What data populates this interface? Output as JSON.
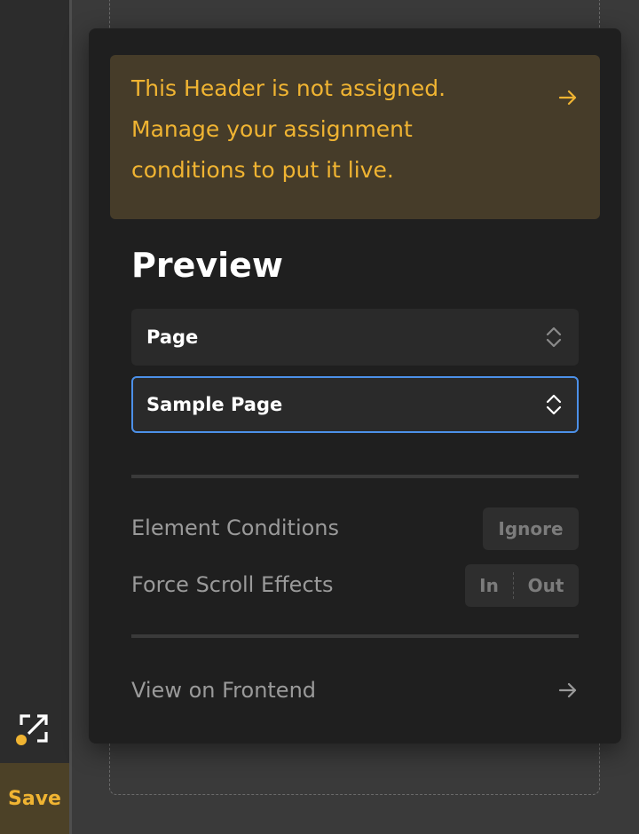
{
  "sidebar": {
    "save_label": "Save"
  },
  "notice": {
    "message": "This Header is not assigned. Manage your assignment conditions to put it live.",
    "color": "#f0b432",
    "icon": "arrow-right-icon"
  },
  "preview": {
    "title": "Preview",
    "type_select": {
      "value": "Page",
      "icon": "chevron-up-down-icon"
    },
    "item_select": {
      "value": "Sample Page",
      "icon": "chevron-up-down-icon",
      "focus_color": "#4c90e8"
    },
    "element_conditions": {
      "label": "Element Conditions",
      "button_label": "Ignore"
    },
    "force_scroll_effects": {
      "label": "Force Scroll Effects",
      "in_label": "In",
      "out_label": "Out"
    },
    "view_frontend": {
      "label": "View on Frontend",
      "icon": "arrow-right-icon"
    }
  }
}
